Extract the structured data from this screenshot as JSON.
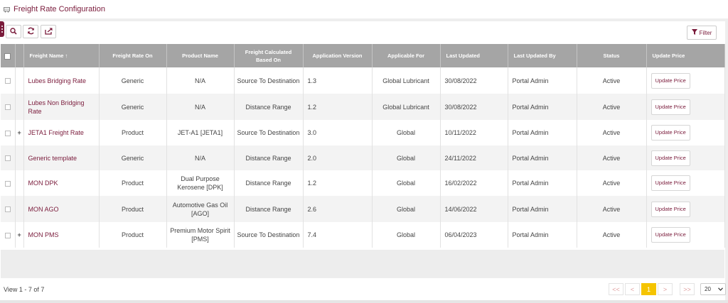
{
  "header": {
    "title": "Freight Rate Configuration",
    "icon": "truck-icon"
  },
  "toolbar": {
    "buttons": [
      {
        "name": "search-button",
        "icon": "search-icon"
      },
      {
        "name": "refresh-button",
        "icon": "refresh-icon"
      },
      {
        "name": "export-button",
        "icon": "export-icon"
      }
    ],
    "filter_label": "Filter"
  },
  "table": {
    "columns": {
      "freight_name": "Freight Name",
      "sort_indicator": "↑",
      "rate_on": "Freight Rate On",
      "product_name": "Product Name",
      "calc_based_on": "Freight Calculated Based On",
      "app_version": "Application Version",
      "applicable_for": "Applicable For",
      "last_updated": "Last Updated",
      "last_updated_by": "Last Updated By",
      "status": "Status",
      "update_price": "Update Price"
    },
    "rows": [
      {
        "expand": "",
        "name": "Lubes Bridging Rate",
        "rate_on": "Generic",
        "product": "N/A",
        "calc": "Source To Destination",
        "version": "1.3",
        "applicable": "Global Lubricant",
        "updated": "30/08/2022",
        "by": "Portal Admin",
        "status": "Active",
        "action": "Update Price"
      },
      {
        "expand": "",
        "name": "Lubes Non Bridging Rate",
        "rate_on": "Generic",
        "product": "N/A",
        "calc": "Distance Range",
        "version": "1.2",
        "applicable": "Global Lubricant",
        "updated": "30/08/2022",
        "by": "Portal Admin",
        "status": "Active",
        "action": "Update Price"
      },
      {
        "expand": "+",
        "name": "JETA1 Freight Rate",
        "rate_on": "Product",
        "product": "JET-A1 [JETA1]",
        "calc": "Source To Destination",
        "version": "3.0",
        "applicable": "Global",
        "updated": "10/11/2022",
        "by": "Portal Admin",
        "status": "Active",
        "action": "Update Price"
      },
      {
        "expand": "",
        "name": "Generic template",
        "rate_on": "Generic",
        "product": "N/A",
        "calc": "Distance Range",
        "version": "2.0",
        "applicable": "Global",
        "updated": "24/11/2022",
        "by": "Portal Admin",
        "status": "Active",
        "action": "Update Price"
      },
      {
        "expand": "",
        "name": "MON DPK",
        "rate_on": "Product",
        "product": "Dual Purpose Kerosene [DPK]",
        "calc": "Distance Range",
        "version": "1.2",
        "applicable": "Global",
        "updated": "16/02/2022",
        "by": "Portal Admin",
        "status": "Active",
        "action": "Update Price"
      },
      {
        "expand": "",
        "name": "MON AGO",
        "rate_on": "Product",
        "product": "Automotive Gas Oil [AGO]",
        "calc": "Distance Range",
        "version": "2.6",
        "applicable": "Global",
        "updated": "14/06/2022",
        "by": "Portal Admin",
        "status": "Active",
        "action": "Update Price"
      },
      {
        "expand": "+",
        "name": "MON PMS",
        "rate_on": "Product",
        "product": "Premium Motor Spirit [PMS]",
        "calc": "Source To Destination",
        "version": "7.4",
        "applicable": "Global",
        "updated": "06/04/2023",
        "by": "Portal Admin",
        "status": "Active",
        "action": "Update Price"
      }
    ]
  },
  "footer": {
    "view_info": "View 1 - 7 of 7",
    "pager": {
      "first": "<<",
      "prev": "<",
      "current": "1",
      "next": ">",
      "last": ">>"
    },
    "page_size": "20"
  },
  "colors": {
    "brand": "#7a1b3b",
    "header_bg": "#a5a5a5",
    "active_page": "#f5c400"
  }
}
